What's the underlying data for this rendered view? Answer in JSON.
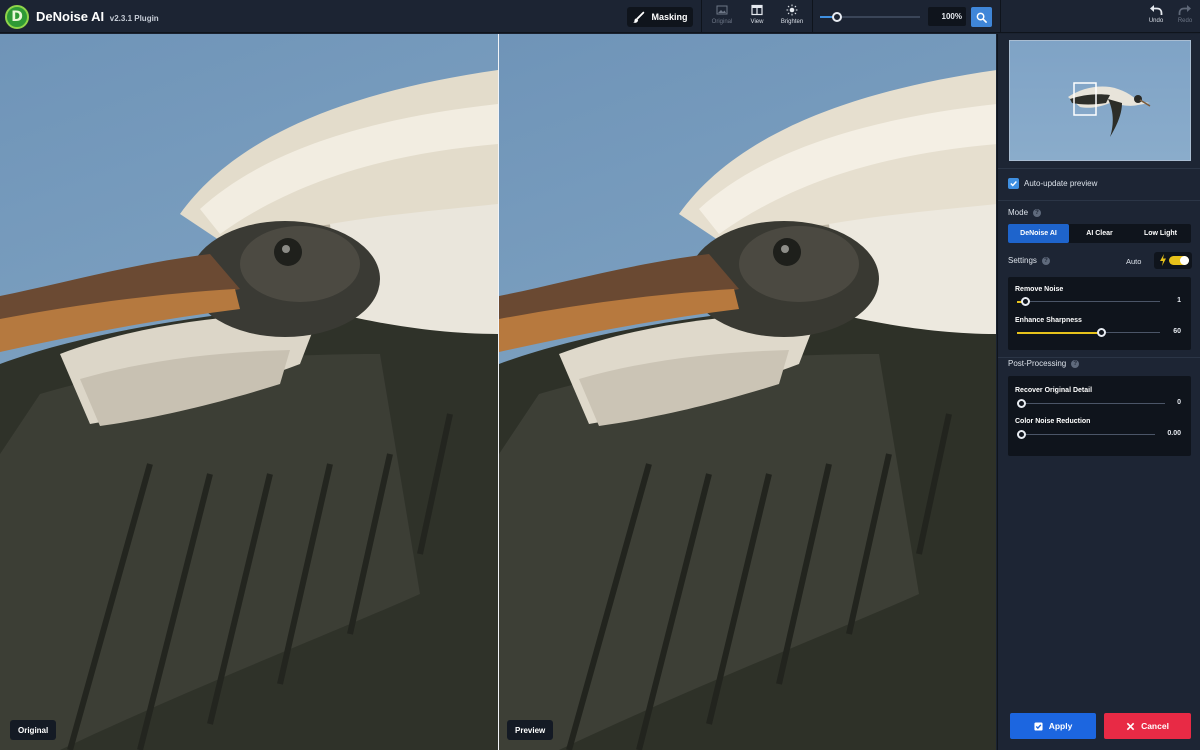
{
  "app": {
    "logo_letter": "D",
    "name": "DeNoise AI",
    "version": "v2.3.1 Plugin"
  },
  "toolbar": {
    "masking_label": "Masking",
    "original_label": "Original",
    "view_label": "View",
    "brighten_label": "Brighten",
    "zoom_value": "100%",
    "zoom_level_fraction": 0.16,
    "undo_label": "Undo",
    "redo_label": "Redo"
  },
  "viewer": {
    "left_label": "Original",
    "right_label": "Preview"
  },
  "panel": {
    "auto_update_label": "Auto-update preview",
    "auto_update_checked": true,
    "mode_title": "Mode",
    "modes": [
      "DeNoise AI",
      "AI Clear",
      "Low Light"
    ],
    "active_mode": "DeNoise AI",
    "settings_title": "Settings",
    "auto_label": "Auto",
    "auto_enabled": true,
    "remove_noise": {
      "label": "Remove Noise",
      "value": "1",
      "fraction": 0.06
    },
    "enhance_sharpness": {
      "label": "Enhance Sharpness",
      "value": "60",
      "fraction": 0.6
    },
    "post_title": "Post-Processing",
    "recover_detail": {
      "label": "Recover Original Detail",
      "value": "0",
      "fraction": 0.0
    },
    "color_noise": {
      "label": "Color Noise Reduction",
      "value": "0.00",
      "fraction": 0.0
    },
    "apply_label": "Apply",
    "cancel_label": "Cancel"
  },
  "colors": {
    "accent_blue": "#1c66e0",
    "accent_yellow": "#e6c21c",
    "cancel_red": "#e82a45",
    "panel_bg": "#1d2534"
  },
  "icons": [
    "brush-icon",
    "image-icon",
    "view-split-icon",
    "sun-icon",
    "search-icon",
    "undo-icon",
    "redo-icon",
    "check-icon",
    "bolt-icon",
    "close-icon"
  ]
}
